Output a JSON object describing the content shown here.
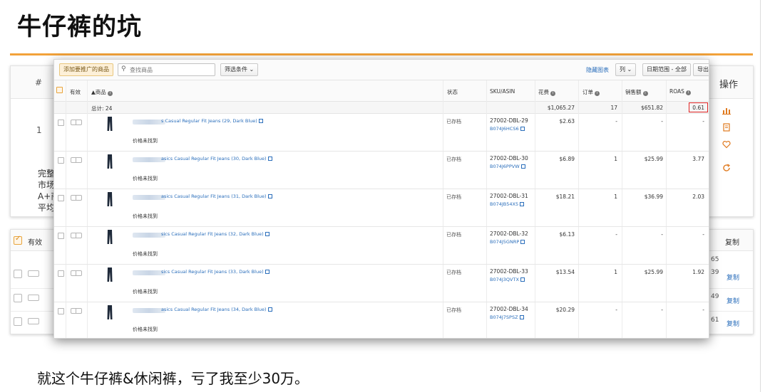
{
  "title": "牛仔裤的坑",
  "caption": "就这个牛仔裤&休闲裤，亏了我至少30万。",
  "background_table": {
    "header_hash": "#",
    "header_ops": "操作",
    "row_number": "1",
    "side_texts": [
      "完整",
      "市场",
      "A+商",
      "平均"
    ],
    "bottom_header_active": "有效",
    "bottom_header_copy": "复制",
    "bottom_values": [
      "65",
      "39",
      "49",
      "61"
    ],
    "copy_label": "复制",
    "icons": [
      "bar-chart-icon",
      "document-icon",
      "heart-icon",
      "refresh-icon"
    ]
  },
  "toolbar": {
    "add_button": "添加要推广的商品",
    "search_placeholder": "查找商品",
    "filter_button": "筛选条件",
    "hide_chart": "隐藏图表",
    "columns_button": "列",
    "date_range_button": "日期范围 - 全部",
    "export_button": "导出"
  },
  "columns": {
    "active": "有效",
    "product": "▲商品",
    "status": "状态",
    "sku_asin": "SKU/ASIN",
    "spend": "花费",
    "orders": "订单",
    "sales": "销售额",
    "roas": "ROAS"
  },
  "totals": {
    "label": "总计: 24",
    "spend": "$1,065.27",
    "orders": "17",
    "sales": "$651.82",
    "roas": "0.61"
  },
  "rows": [
    {
      "name": "s Casual Regular Fit Jeans (29, Dark Blue)",
      "price_note": "价格未找到",
      "status": "已存档",
      "sku": "27002-DBL-29",
      "asin": "B074J6HCS6",
      "spend": "$2.63",
      "orders": "-",
      "sales": "-",
      "roas": "-"
    },
    {
      "name": "asics Casual Regular Fit Jeans (30, Dark Blue)",
      "price_note": "价格未找到",
      "status": "已存档",
      "sku": "27002-DBL-30",
      "asin": "B074J6PPVW",
      "spend": "$6.89",
      "orders": "1",
      "sales": "$25.99",
      "roas": "3.77"
    },
    {
      "name": "asics Casual Regular Fit Jeans (31, Dark Blue)",
      "price_note": "价格未找到",
      "status": "已存档",
      "sku": "27002-DBL-31",
      "asin": "B074JB54X5",
      "spend": "$18.21",
      "orders": "1",
      "sales": "$36.99",
      "roas": "2.03"
    },
    {
      "name": "sics Casual Regular Fit Jeans (32, Dark Blue)",
      "price_note": "价格未找到",
      "status": "已存档",
      "sku": "27002-DBL-32",
      "asin": "B074J5GNRP",
      "spend": "$6.13",
      "orders": "-",
      "sales": "-",
      "roas": "-"
    },
    {
      "name": "sics Casual Regular Fit Jeans (33, Dark Blue)",
      "price_note": "价格未找到",
      "status": "已存档",
      "sku": "27002-DBL-33",
      "asin": "B074J3QVTX",
      "spend": "$13.54",
      "orders": "1",
      "sales": "$25.99",
      "roas": "1.92"
    },
    {
      "name": "asics Casual Regular Fit Jeans (34, Dark Blue)",
      "price_note": "价格未找到",
      "status": "已存档",
      "sku": "27002-DBL-34",
      "asin": "B074J7SPSZ",
      "spend": "$20.29",
      "orders": "-",
      "sales": "-",
      "roas": "-"
    }
  ],
  "colors": {
    "accent_orange": "#f2a23a",
    "link_blue": "#2a6ebb",
    "highlight_red": "#e02424"
  }
}
